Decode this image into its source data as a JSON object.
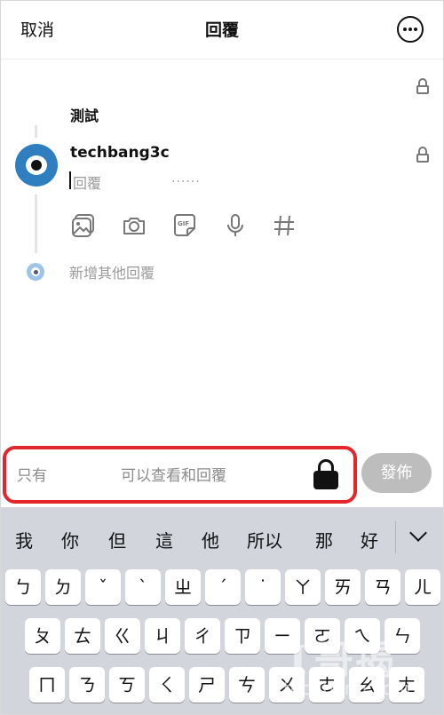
{
  "header": {
    "cancel_label": "取消",
    "title": "回覆",
    "more_icon": "more-horizontal-icon"
  },
  "thread": {
    "previous_post_text": "測試",
    "username": "techbang3c",
    "reply_placeholder": "回覆",
    "typing_dots": "......",
    "tools": [
      "image-icon",
      "camera-icon",
      "gif-icon",
      "mic-icon",
      "hashtag-icon"
    ],
    "add_reply_label": "新增其他回覆"
  },
  "reply_setting": {
    "only_label": "只有",
    "can_view_label": "可以查看和回覆",
    "post_label": "發佈",
    "highlight_color": "#e2262c"
  },
  "keyboard": {
    "suggestions": [
      "我",
      "你",
      "但",
      "這",
      "他",
      "所以",
      "那",
      "好"
    ],
    "rows": [
      [
        "ㄅ",
        "ㄉ",
        "ˇ",
        "ˋ",
        "ㄓ",
        "ˊ",
        "˙",
        "ㄚ",
        "ㄞ",
        "ㄢ",
        "ㄦ"
      ],
      [
        "ㄆ",
        "ㄊ",
        "ㄍ",
        "ㄐ",
        "ㄔ",
        "ㄗ",
        "ㄧ",
        "ㄛ",
        "ㄟ",
        "ㄣ"
      ],
      [
        "ㄇ",
        "ㄋ",
        "ㄎ",
        "ㄑ",
        "ㄕ",
        "ㄘ",
        "ㄨ",
        "ㄜ",
        "ㄠ",
        "ㄤ"
      ]
    ]
  },
  "watermark": {
    "main": "T哥揭",
    "sub": "techbang.com"
  }
}
